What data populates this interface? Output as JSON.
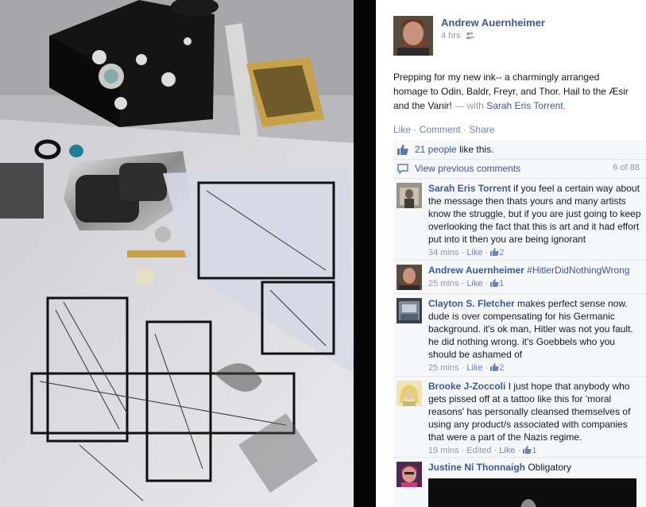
{
  "post": {
    "author": "Andrew Auernheimer",
    "time": "4 hrs",
    "privacy_icon": "friends-icon",
    "text": "Prepping for my new ink-- a charmingly arranged homage to Odin, Baldr, Freyr, and Thor. Hail to the Æsir and the Vanir!",
    "with_prefix": "— with",
    "tagged": "Sarah Eris Torrent",
    "tag_suffix": "."
  },
  "actions": {
    "like": "Like",
    "comment": "Comment",
    "share": "Share",
    "sep": "·"
  },
  "likes": {
    "count_text": "21 people",
    "suffix": "like this."
  },
  "previous": {
    "label": "View previous comments",
    "count": "6 of 88"
  },
  "comments": [
    {
      "name": "Sarah Eris Torrent",
      "text": "if you feel a certain way about the message then thats yours and many artists know the struggle, but if you are just going to keep overlooking the fact that this is art and it had effort put into it then you are being ignorant",
      "time": "34 mins",
      "edited": "",
      "like": "Like",
      "likes": "2"
    },
    {
      "name": "Andrew Auernheimer",
      "text": "#HitlerDidNothingWrong",
      "time": "25 mins",
      "edited": "",
      "like": "Like",
      "likes": "1"
    },
    {
      "name": "Clayton S. Fletcher",
      "text": "makes perfect sense now. dude is over compensating for his Germanic background. it's ok man, Hitler was not you fault. he did nothing wrong. it's Goebbels who you should be ashamed of",
      "time": "25 mins",
      "edited": "",
      "like": "Like",
      "likes": "2"
    },
    {
      "name": "Brooke J-Zoccoli",
      "text": "I just hope that anybody who gets pissed off at a tattoo like this for 'moral reasons' has personally cleansed themselves of using any product/s associated with companies that were a part of the Nazis regime.",
      "time": "19 mins",
      "edited": "Edited",
      "like": "Like",
      "likes": "1"
    },
    {
      "name": "Justine Ní Thonnaigh",
      "text": "Obligatory",
      "time": "",
      "edited": "",
      "like": "",
      "likes": ""
    }
  ],
  "colors": {
    "link": "#3b5998",
    "meta": "#9197a3",
    "ufi_bg": "#f6f7f9"
  }
}
